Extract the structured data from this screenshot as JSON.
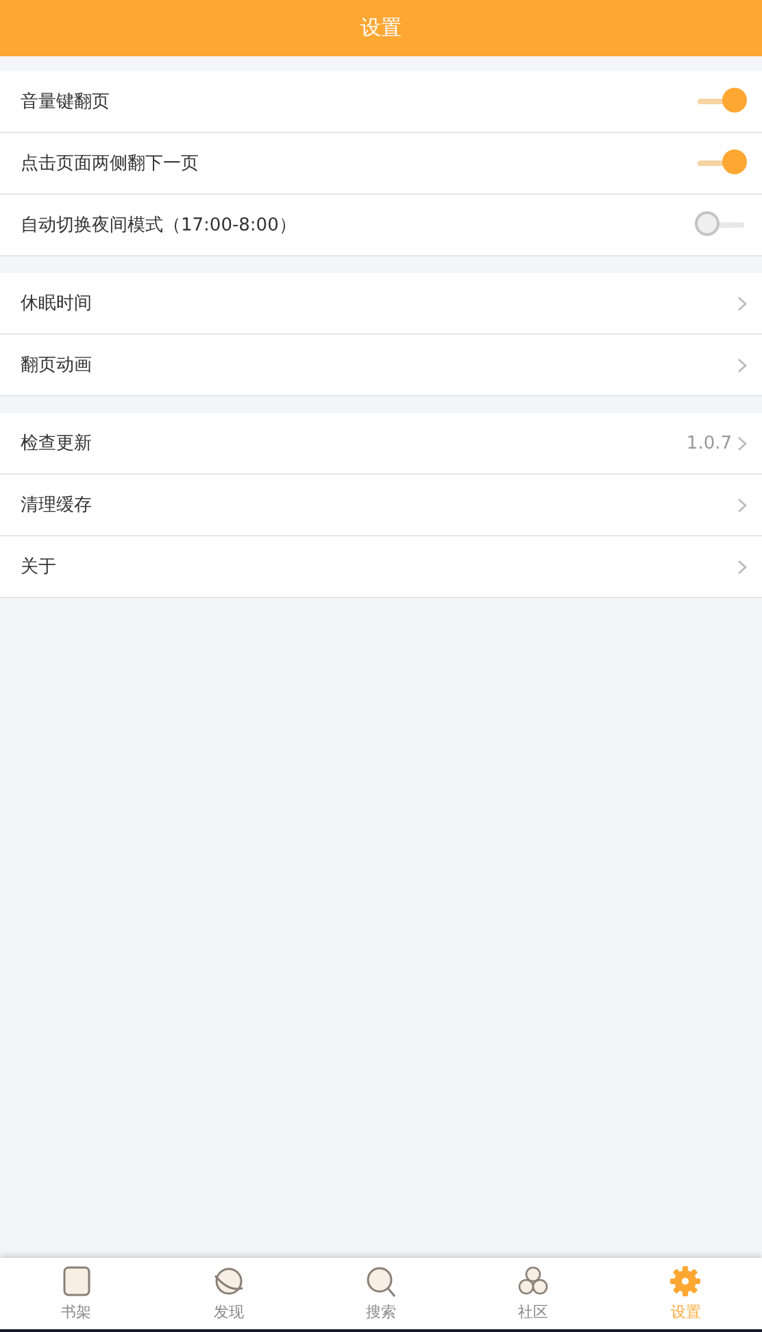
{
  "header": {
    "title": "设置"
  },
  "sections": [
    {
      "rows": [
        {
          "label": "音量键翻页",
          "kind": "toggle",
          "on": true
        },
        {
          "label": "点击页面两侧翻下一页",
          "kind": "toggle",
          "on": true
        },
        {
          "label": "自动切换夜间模式（17:00-8:00）",
          "kind": "toggle",
          "on": false
        }
      ]
    },
    {
      "rows": [
        {
          "label": "休眠时间",
          "kind": "link"
        },
        {
          "label": "翻页动画",
          "kind": "link"
        }
      ]
    },
    {
      "rows": [
        {
          "label": "检查更新",
          "kind": "link",
          "value": "1.0.7"
        },
        {
          "label": "清理缓存",
          "kind": "link"
        },
        {
          "label": "关于",
          "kind": "link"
        }
      ]
    }
  ],
  "tabs": [
    {
      "label": "书架",
      "kind": "shelf",
      "selected": false
    },
    {
      "label": "发现",
      "kind": "discover",
      "selected": false
    },
    {
      "label": "搜索",
      "kind": "search",
      "selected": false
    },
    {
      "label": "社区",
      "kind": "community",
      "selected": false
    },
    {
      "label": "设置",
      "kind": "settings",
      "selected": true
    }
  ]
}
